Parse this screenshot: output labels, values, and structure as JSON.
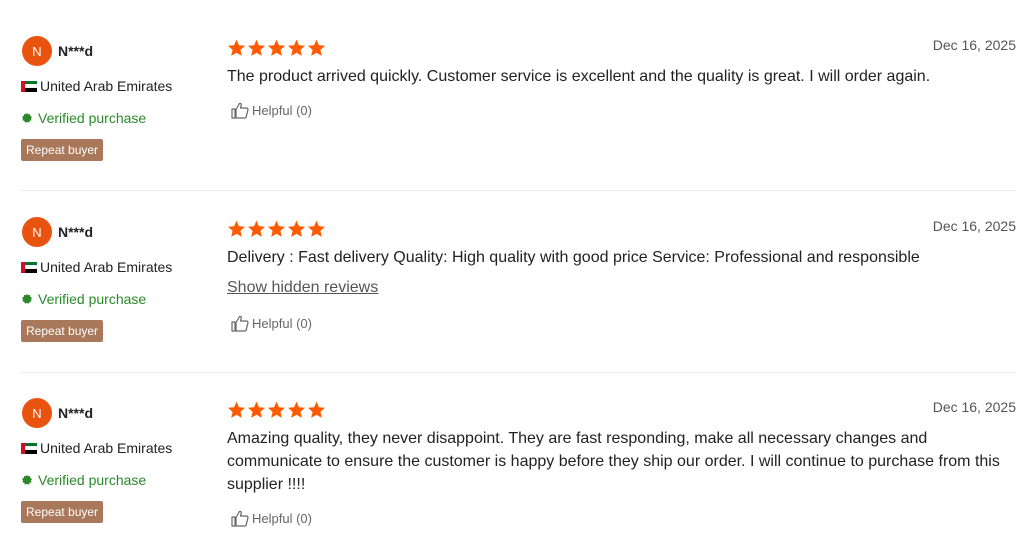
{
  "reviews": [
    {
      "avatar_letter": "N",
      "username": "N***d",
      "country": "United Arab Emirates",
      "verified": "Verified purchase",
      "badge": "Repeat buyer",
      "rating": 5,
      "date": "Dec 16, 2025",
      "text": "The product arrived quickly. Customer service is excellent and the quality is great. I will order again.",
      "show_hidden": "",
      "helpful": "Helpful (0)"
    },
    {
      "avatar_letter": "N",
      "username": "N***d",
      "country": "United Arab Emirates",
      "verified": "Verified purchase",
      "badge": "Repeat buyer",
      "rating": 5,
      "date": "Dec 16, 2025",
      "text": "Delivery : Fast delivery Quality: High quality with good price Service: Professional and responsible",
      "show_hidden": "Show hidden reviews",
      "helpful": "Helpful (0)"
    },
    {
      "avatar_letter": "N",
      "username": "N***d",
      "country": "United Arab Emirates",
      "verified": "Verified purchase",
      "badge": "Repeat buyer",
      "rating": 5,
      "date": "Dec 16, 2025",
      "text": "Amazing quality, they never disappoint. They are fast responding, make all necessary changes and communicate to ensure the customer is happy before they ship our order. I will continue to purchase from this supplier !!!!",
      "show_hidden": "",
      "helpful": "Helpful (0)"
    }
  ],
  "colors": {
    "star": "#ff5a00",
    "avatar": "#e8530f",
    "verified": "#2a8a2a",
    "badge": "#a9785a"
  },
  "icons": {
    "star": "star-icon",
    "flag": "uae-flag-icon",
    "verified": "verified-icon",
    "helpful": "thumbs-up-icon"
  }
}
